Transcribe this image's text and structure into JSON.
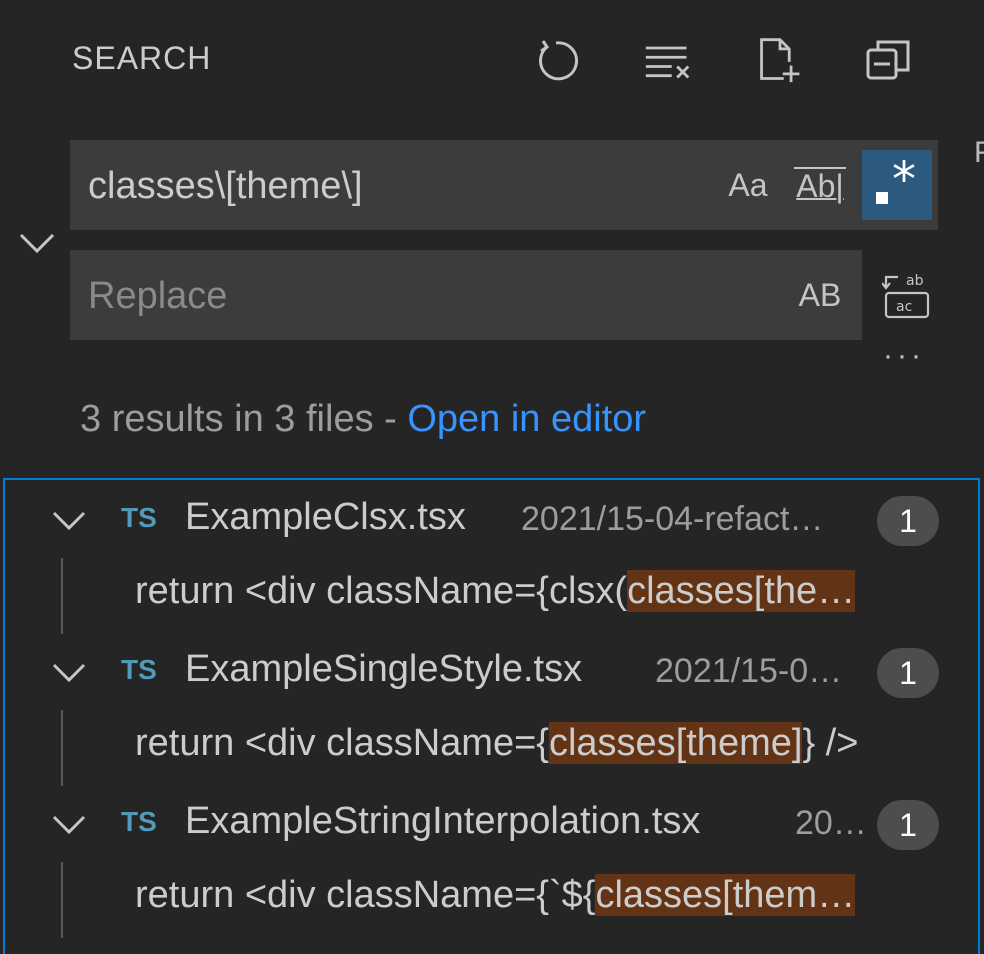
{
  "header": {
    "title": "SEARCH",
    "actions": [
      "refresh-icon",
      "clear-results-icon",
      "new-search-editor-icon",
      "collapse-all-icon"
    ]
  },
  "edge_glyph": "F",
  "search": {
    "query": "classes\\[theme\\]",
    "match_case_label": "Aa",
    "whole_word_label": "Ab|",
    "regex_active": true
  },
  "replace": {
    "placeholder": "Replace",
    "preserve_case_label": "AB",
    "replace_all_icon": "replace-all-icon"
  },
  "more_label": "···",
  "summary": {
    "text": "3 results in 3 files - ",
    "link": "Open in editor"
  },
  "results": [
    {
      "badge": "TS",
      "file": "ExampleClsx.tsx",
      "path": "2021/15-04-refact…",
      "count": "1",
      "match": {
        "before": "return <div className={clsx(",
        "highlight": "classes[the…",
        "after": ""
      }
    },
    {
      "badge": "TS",
      "file": "ExampleSingleStyle.tsx",
      "path": "2021/15-0…",
      "count": "1",
      "match": {
        "before": "return <div className={",
        "highlight": "classes[theme]",
        "after": "} />"
      }
    },
    {
      "badge": "TS",
      "file": "ExampleStringInterpolation.tsx",
      "path": "20…",
      "count": "1",
      "match": {
        "before": "return <div className={`${",
        "highlight": "classes[them…",
        "after": ""
      }
    }
  ]
}
